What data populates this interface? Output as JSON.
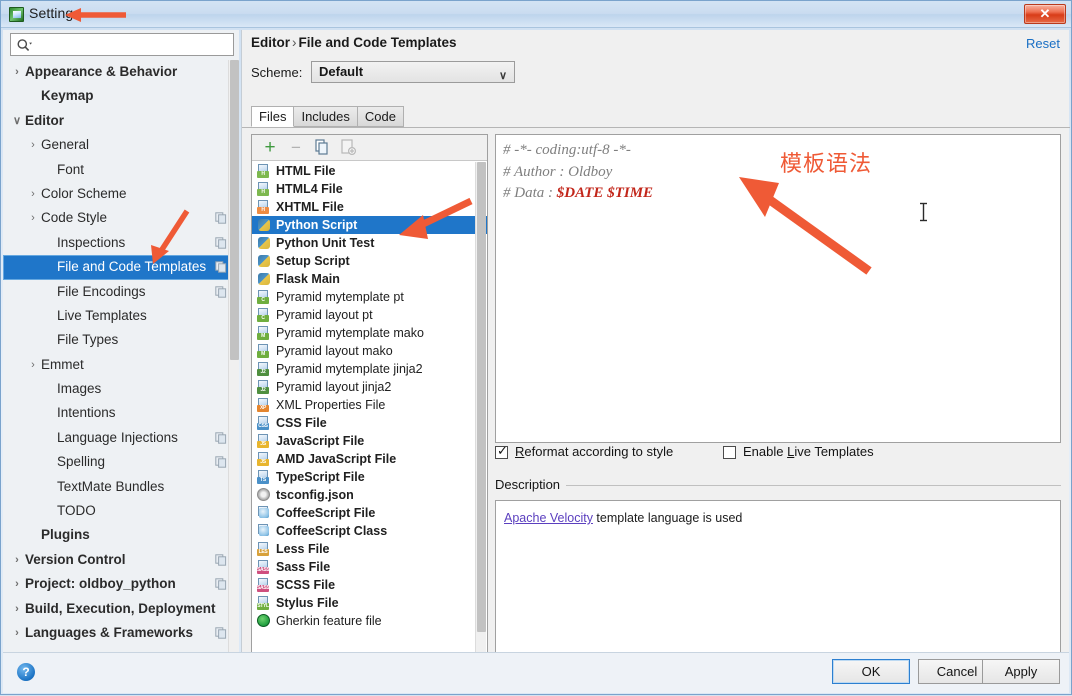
{
  "window": {
    "title": "Settings",
    "icon": "settings-app-icon",
    "close_label": "✕",
    "accent_blue": "#1f76c9",
    "annotation_orange": "#ef5a36"
  },
  "sidebar": {
    "search": {
      "value": "",
      "placeholder": "",
      "icon": "search-icon"
    },
    "items": [
      {
        "label": "Appearance & Behavior",
        "indent": 8,
        "twisty": "›",
        "bold": true,
        "selected": false,
        "badge": false
      },
      {
        "label": "Keymap",
        "indent": 24,
        "twisty": "",
        "bold": true,
        "selected": false,
        "badge": false
      },
      {
        "label": "Editor",
        "indent": 8,
        "twisty": "∨",
        "bold": true,
        "selected": false,
        "badge": false
      },
      {
        "label": "General",
        "indent": 24,
        "twisty": "›",
        "bold": false,
        "selected": false,
        "badge": false
      },
      {
        "label": "Font",
        "indent": 40,
        "twisty": "",
        "bold": false,
        "selected": false,
        "badge": false
      },
      {
        "label": "Color Scheme",
        "indent": 24,
        "twisty": "›",
        "bold": false,
        "selected": false,
        "badge": false
      },
      {
        "label": "Code Style",
        "indent": 24,
        "twisty": "›",
        "bold": false,
        "selected": false,
        "badge": true
      },
      {
        "label": "Inspections",
        "indent": 40,
        "twisty": "",
        "bold": false,
        "selected": false,
        "badge": true
      },
      {
        "label": "File and Code Templates",
        "indent": 40,
        "twisty": "",
        "bold": false,
        "selected": true,
        "badge": true
      },
      {
        "label": "File Encodings",
        "indent": 40,
        "twisty": "",
        "bold": false,
        "selected": false,
        "badge": true
      },
      {
        "label": "Live Templates",
        "indent": 40,
        "twisty": "",
        "bold": false,
        "selected": false,
        "badge": false
      },
      {
        "label": "File Types",
        "indent": 40,
        "twisty": "",
        "bold": false,
        "selected": false,
        "badge": false
      },
      {
        "label": "Emmet",
        "indent": 24,
        "twisty": "›",
        "bold": false,
        "selected": false,
        "badge": false
      },
      {
        "label": "Images",
        "indent": 40,
        "twisty": "",
        "bold": false,
        "selected": false,
        "badge": false
      },
      {
        "label": "Intentions",
        "indent": 40,
        "twisty": "",
        "bold": false,
        "selected": false,
        "badge": false
      },
      {
        "label": "Language Injections",
        "indent": 40,
        "twisty": "",
        "bold": false,
        "selected": false,
        "badge": true
      },
      {
        "label": "Spelling",
        "indent": 40,
        "twisty": "",
        "bold": false,
        "selected": false,
        "badge": true
      },
      {
        "label": "TextMate Bundles",
        "indent": 40,
        "twisty": "",
        "bold": false,
        "selected": false,
        "badge": false
      },
      {
        "label": "TODO",
        "indent": 40,
        "twisty": "",
        "bold": false,
        "selected": false,
        "badge": false
      },
      {
        "label": "Plugins",
        "indent": 24,
        "twisty": "",
        "bold": true,
        "selected": false,
        "badge": false
      },
      {
        "label": "Version Control",
        "indent": 8,
        "twisty": "›",
        "bold": true,
        "selected": false,
        "badge": true
      },
      {
        "label": "Project: oldboy_python",
        "indent": 8,
        "twisty": "›",
        "bold": true,
        "selected": false,
        "badge": true
      },
      {
        "label": "Build, Execution, Deployment",
        "indent": 8,
        "twisty": "›",
        "bold": true,
        "selected": false,
        "badge": false
      },
      {
        "label": "Languages & Frameworks",
        "indent": 8,
        "twisty": "›",
        "bold": true,
        "selected": false,
        "badge": true
      }
    ]
  },
  "content": {
    "breadcrumb": {
      "parent": "Editor",
      "separator": "›",
      "current": "File and Code Templates"
    },
    "reset_label": "Reset",
    "scheme": {
      "label": "Scheme:",
      "value": "Default",
      "caret": "∨"
    },
    "tabs": [
      {
        "label": "Files",
        "active": true
      },
      {
        "label": "Includes",
        "active": false
      },
      {
        "label": "Code",
        "active": false
      }
    ],
    "list_toolbar": [
      {
        "name": "add-template-button",
        "glyph": "+",
        "enabled": true
      },
      {
        "name": "remove-template-button",
        "glyph": "−",
        "enabled": false
      },
      {
        "name": "copy-template-button",
        "glyph": "copy",
        "enabled": true
      },
      {
        "name": "save-template-button",
        "glyph": "save",
        "enabled": false
      }
    ],
    "templates": [
      {
        "label": "HTML File",
        "icon": "html-file-icon",
        "tag": "H",
        "tagColor": "#7db84f",
        "bold": true
      },
      {
        "label": "HTML4 File",
        "icon": "html4-file-icon",
        "tag": "H",
        "tagColor": "#7db84f",
        "bold": true
      },
      {
        "label": "XHTML File",
        "icon": "xhtml-file-icon",
        "tag": "H",
        "tagColor": "#ef8b41",
        "bold": true
      },
      {
        "label": "Python Script",
        "icon": "python-file-icon",
        "tag": "",
        "tagColor": "",
        "bold": true,
        "selected": true
      },
      {
        "label": "Python Unit Test",
        "icon": "python-file-icon",
        "tag": "",
        "tagColor": "",
        "bold": true
      },
      {
        "label": "Setup Script",
        "icon": "python-file-icon",
        "tag": "",
        "tagColor": "",
        "bold": true
      },
      {
        "label": "Flask Main",
        "icon": "python-file-icon",
        "tag": "",
        "tagColor": "",
        "bold": true
      },
      {
        "label": "Pyramid mytemplate pt",
        "icon": "chameleon-file-icon",
        "tag": "C",
        "tagColor": "#6fae3f",
        "bold": false
      },
      {
        "label": "Pyramid layout pt",
        "icon": "chameleon-file-icon",
        "tag": "C",
        "tagColor": "#6fae3f",
        "bold": false
      },
      {
        "label": "Pyramid mytemplate mako",
        "icon": "mako-file-icon",
        "tag": "M",
        "tagColor": "#6fae3f",
        "bold": false
      },
      {
        "label": "Pyramid layout mako",
        "icon": "mako-file-icon",
        "tag": "M",
        "tagColor": "#6fae3f",
        "bold": false
      },
      {
        "label": "Pyramid mytemplate jinja2",
        "icon": "jinja2-file-icon",
        "tag": "J2",
        "tagColor": "#4f8f3f",
        "bold": false
      },
      {
        "label": "Pyramid layout jinja2",
        "icon": "jinja2-file-icon",
        "tag": "J2",
        "tagColor": "#4f8f3f",
        "bold": false
      },
      {
        "label": "XML Properties File",
        "icon": "xml-properties-icon",
        "tag": "XP",
        "tagColor": "#e4852e",
        "bold": false
      },
      {
        "label": "CSS File",
        "icon": "css-file-icon",
        "tag": "CSS",
        "tagColor": "#4a90c8",
        "bold": true
      },
      {
        "label": "JavaScript File",
        "icon": "javascript-file-icon",
        "tag": "JS",
        "tagColor": "#e8b52e",
        "bold": true
      },
      {
        "label": "AMD JavaScript File",
        "icon": "javascript-file-icon",
        "tag": "JS",
        "tagColor": "#e8b52e",
        "bold": true
      },
      {
        "label": "TypeScript File",
        "icon": "typescript-file-icon",
        "tag": "TS",
        "tagColor": "#4a90c8",
        "bold": true
      },
      {
        "label": "tsconfig.json",
        "icon": "tsconfig-gear-icon",
        "tag": "",
        "tagColor": "",
        "bold": true
      },
      {
        "label": "CoffeeScript File",
        "icon": "coffeescript-icon",
        "tag": "",
        "tagColor": "",
        "bold": true
      },
      {
        "label": "CoffeeScript Class",
        "icon": "coffeescript-icon",
        "tag": "",
        "tagColor": "",
        "bold": true
      },
      {
        "label": "Less File",
        "icon": "less-file-icon",
        "tag": "LES",
        "tagColor": "#d8a13a",
        "bold": true
      },
      {
        "label": "Sass File",
        "icon": "sass-file-icon",
        "tag": "SASS",
        "tagColor": "#cf4f7e",
        "bold": true
      },
      {
        "label": "SCSS File",
        "icon": "scss-file-icon",
        "tag": "SASS",
        "tagColor": "#cf4f7e",
        "bold": true
      },
      {
        "label": "Stylus File",
        "icon": "stylus-file-icon",
        "tag": "STYL",
        "tagColor": "#6fae3f",
        "bold": true
      },
      {
        "label": "Gherkin feature file",
        "icon": "gherkin-feature-icon",
        "tag": "",
        "tagColor": "",
        "bold": false
      }
    ],
    "editor": {
      "line1_prefix": "# -*- coding:utf-8 -*-",
      "line2_prefix": "# Author : Oldboy",
      "line3_prefix": "# Data : ",
      "line3_var1": "$DATE",
      "line3_var2": "$TIME"
    },
    "checkboxes": [
      {
        "label_before": "",
        "mnemonic": "R",
        "label_after": "eformat according to style",
        "checked": true,
        "name": "reformat-according-to-style-checkbox"
      },
      {
        "label_before": "Enable ",
        "mnemonic": "L",
        "label_after": "ive Templates",
        "checked": false,
        "name": "enable-live-templates-checkbox"
      }
    ],
    "description": {
      "title": "Description",
      "link_text": "Apache Velocity",
      "rest_text": " template language is used"
    }
  },
  "footer": {
    "help_label": "?",
    "buttons": [
      {
        "label": "OK",
        "name": "ok-button",
        "primary": true
      },
      {
        "label": "Cancel",
        "name": "cancel-button",
        "primary": false
      },
      {
        "label": "Apply",
        "name": "apply-button",
        "primary": false
      }
    ]
  },
  "annotations": {
    "chinese_note": "模板语法",
    "arrow_count": 4
  }
}
